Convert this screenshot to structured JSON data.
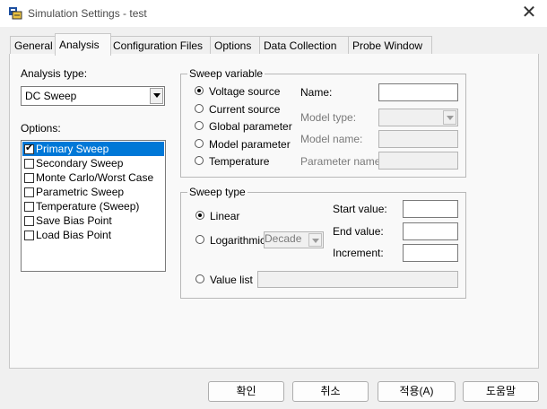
{
  "window": {
    "title": "Simulation Settings - test",
    "close_glyph": "✕"
  },
  "tabs": [
    {
      "label": "General"
    },
    {
      "label": "Analysis"
    },
    {
      "label": "Configuration Files"
    },
    {
      "label": "Options"
    },
    {
      "label": "Data Collection"
    },
    {
      "label": "Probe Window"
    }
  ],
  "analysis_type": {
    "label": "Analysis type:",
    "value": "DC Sweep"
  },
  "options": {
    "label": "Options:",
    "items": [
      {
        "label": "Primary Sweep",
        "checked": true,
        "selected": true,
        "check_glyph": "✔"
      },
      {
        "label": "Secondary Sweep",
        "checked": false
      },
      {
        "label": "Monte Carlo/Worst Case",
        "checked": false
      },
      {
        "label": "Parametric Sweep",
        "checked": false
      },
      {
        "label": "Temperature (Sweep)",
        "checked": false
      },
      {
        "label": "Save Bias Point",
        "checked": false
      },
      {
        "label": "Load Bias Point",
        "checked": false
      }
    ]
  },
  "sweep_variable": {
    "title": "Sweep variable",
    "radios": [
      {
        "label": "Voltage source",
        "checked": true
      },
      {
        "label": "Current source",
        "checked": false
      },
      {
        "label": "Global parameter",
        "checked": false
      },
      {
        "label": "Model parameter",
        "checked": false
      },
      {
        "label": "Temperature",
        "checked": false
      }
    ],
    "name_label": "Name:",
    "model_type_label": "Model type:",
    "model_name_label": "Model name:",
    "parameter_name_label": "Parameter name:"
  },
  "sweep_type": {
    "title": "Sweep type",
    "linear_label": "Linear",
    "logarithmic_label": "Logarithmic",
    "log_unit_value": "Decade",
    "value_list_label": "Value list",
    "start_label": "Start value:",
    "end_label": "End value:",
    "increment_label": "Increment:"
  },
  "buttons": {
    "ok": "확인",
    "cancel": "취소",
    "apply": "적용(A)",
    "help": "도움말"
  }
}
